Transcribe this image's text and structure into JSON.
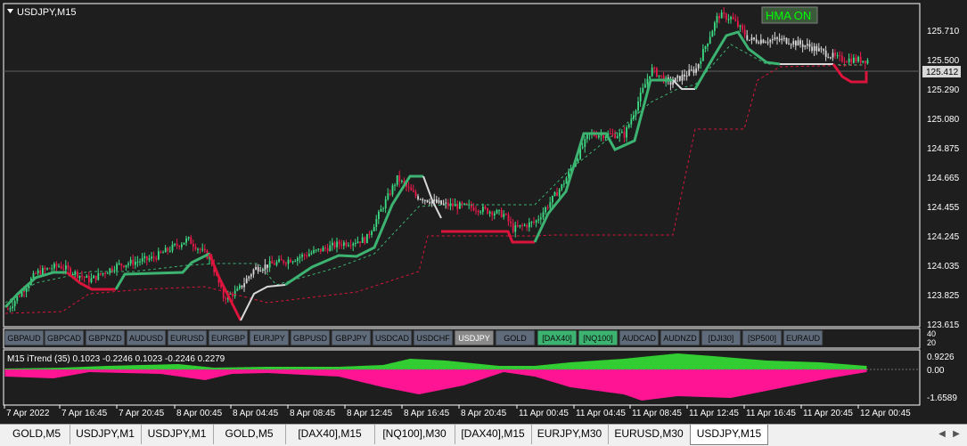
{
  "window": {
    "symbol_title": "USDJPY,M15"
  },
  "hma_button": {
    "label": "HMA ON"
  },
  "price_axis": {
    "labels": [
      "125.710",
      "125.500",
      "125.290",
      "125.080",
      "124.875",
      "124.665",
      "124.455",
      "124.245",
      "124.035",
      "123.825",
      "123.615"
    ],
    "current_price": "125.412"
  },
  "symbol_buttons": [
    {
      "label": "GBPAUD",
      "state": "normal"
    },
    {
      "label": "GBPCAD",
      "state": "normal"
    },
    {
      "label": "GBPNZD",
      "state": "normal"
    },
    {
      "label": "AUDUSD",
      "state": "normal"
    },
    {
      "label": "EURUSD",
      "state": "normal"
    },
    {
      "label": "EURGBP",
      "state": "normal"
    },
    {
      "label": "EURJPY",
      "state": "normal"
    },
    {
      "label": "GBPUSD",
      "state": "normal"
    },
    {
      "label": "GBPJPY",
      "state": "normal"
    },
    {
      "label": "USDCAD",
      "state": "normal"
    },
    {
      "label": "USDCHF",
      "state": "normal"
    },
    {
      "label": "USDJPY",
      "state": "selected"
    },
    {
      "label": "GOLD",
      "state": "normal"
    },
    {
      "label": "[DAX40]",
      "state": "green"
    },
    {
      "label": "[NQ100]",
      "state": "green"
    },
    {
      "label": "AUDCAD",
      "state": "normal"
    },
    {
      "label": "AUDNZD",
      "state": "normal"
    },
    {
      "label": "[DJI30]",
      "state": "normal"
    },
    {
      "label": "[SP500]",
      "state": "normal"
    },
    {
      "label": "EURAUD",
      "state": "normal"
    }
  ],
  "separator_axis": {
    "top": "40",
    "bottom": "20"
  },
  "indicator": {
    "label": "M15  iTrend (35) 0.1023 -0.2246 0.1023 -0.2246 0.2279",
    "axis_labels": [
      "0.9226",
      "0.00",
      "-1.6589"
    ]
  },
  "time_axis": [
    "7 Apr 2022",
    "7 Apr 16:45",
    "7 Apr 20:45",
    "8 Apr 00:45",
    "8 Apr 04:45",
    "8 Apr 08:45",
    "8 Apr 12:45",
    "8 Apr 16:45",
    "8 Apr 20:45",
    "11 Apr 00:45",
    "11 Apr 04:45",
    "11 Apr 08:45",
    "11 Apr 12:45",
    "11 Apr 16:45",
    "11 Apr 20:45",
    "12 Apr 00:45"
  ],
  "tabs": [
    {
      "label": "GOLD,M5",
      "active": false
    },
    {
      "label": "USDJPY,M1",
      "active": false
    },
    {
      "label": "USDJPY,M1",
      "active": false
    },
    {
      "label": "GOLD,M5",
      "active": false
    },
    {
      "label": "[DAX40],M15",
      "active": false
    },
    {
      "label": "[NQ100],M30",
      "active": false
    },
    {
      "label": "[DAX40],M15",
      "active": false
    },
    {
      "label": "EURJPY,M30",
      "active": false
    },
    {
      "label": "EURUSD,M30",
      "active": false
    },
    {
      "label": "USDJPY,M15",
      "active": true
    }
  ],
  "colors": {
    "background": "#1e1e1e",
    "bull": "#3ddc84",
    "bear": "#e8194a",
    "neutral": "#d8d8d8",
    "trend_green": "#3cb371",
    "trend_red": "#dc143c",
    "histo_green": "#32cd32",
    "histo_pink": "#ff1493"
  },
  "icons": {
    "symbol_dropdown": "triangle-down-icon",
    "tab_prev": "arrow-left-icon",
    "tab_next": "arrow-right-icon"
  },
  "chart_data": {
    "type": "line",
    "title": "USDJPY,M15",
    "ylim": [
      123.58,
      125.8
    ],
    "x": [
      "7 Apr 2022",
      "7 Apr 16:45",
      "7 Apr 20:45",
      "8 Apr 00:45",
      "8 Apr 04:45",
      "8 Apr 08:45",
      "8 Apr 12:45",
      "8 Apr 16:45",
      "8 Apr 20:45",
      "11 Apr 00:45",
      "11 Apr 04:45",
      "11 Apr 08:45",
      "11 Apr 12:45",
      "11 Apr 16:45",
      "11 Apr 20:45",
      "12 Apr 00:45"
    ],
    "series": [
      {
        "name": "",
        "values": [
          123.7,
          124.02,
          124.08,
          124.12,
          123.8,
          124.02,
          124.18,
          124.65,
          124.4,
          124.38,
          124.95,
          125.38,
          125.7,
          125.55,
          125.46,
          125.41
        ]
      }
    ],
    "grid": false
  }
}
